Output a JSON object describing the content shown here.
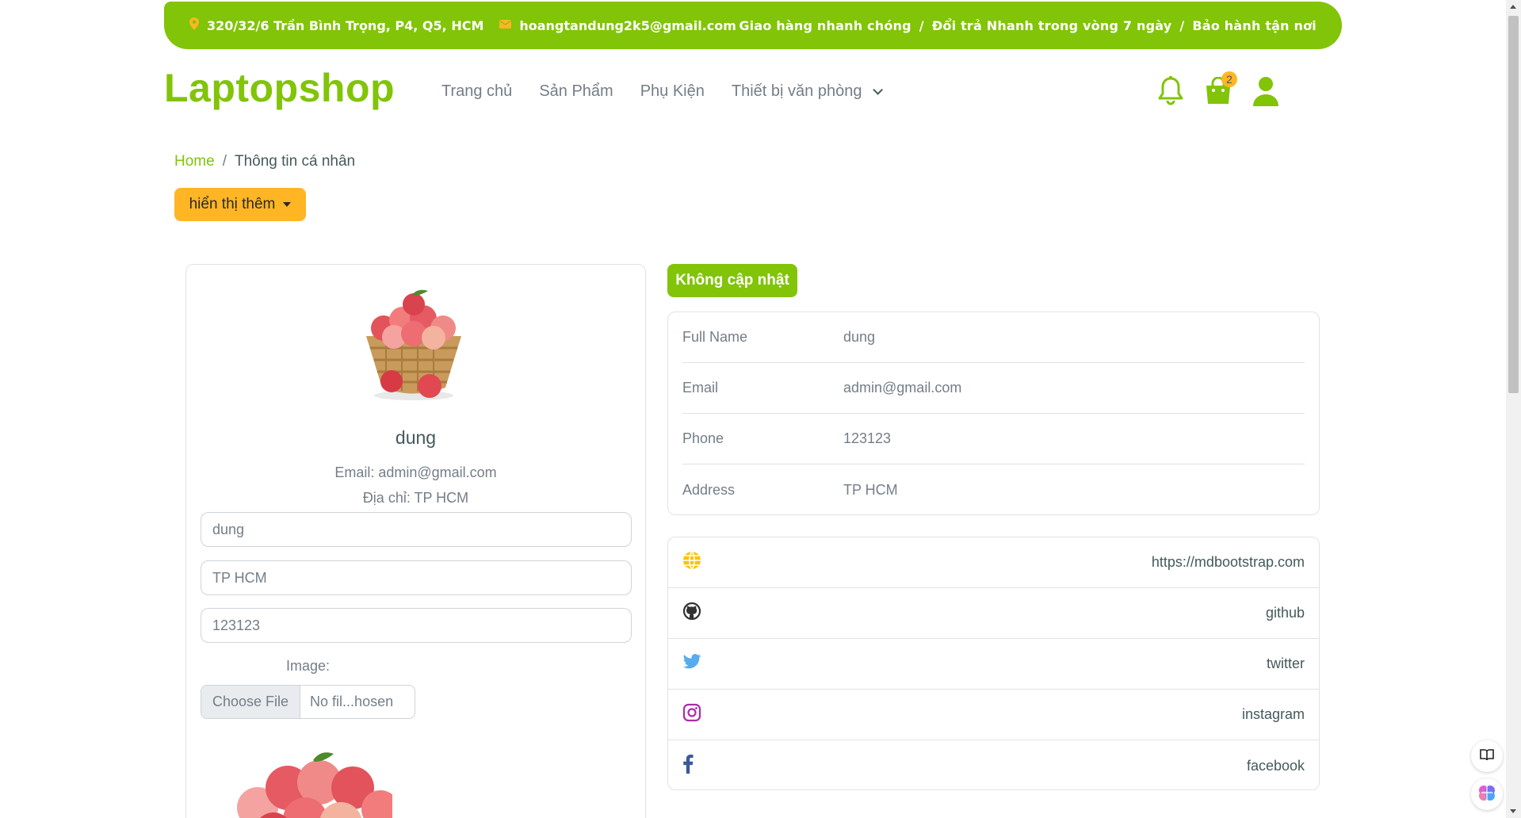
{
  "topbar": {
    "address": "320/32/6 Trần Bình Trọng, P4, Q5, HCM",
    "email": "hoangtandung2k5@gmail.com",
    "promo1": "Giao hàng nhanh chóng",
    "promo2": "Đổi trả Nhanh trong vòng 7 ngày",
    "promo3": "Bảo hành tận nơi",
    "sep": "/"
  },
  "brand": "Laptopshop",
  "nav": {
    "home": "Trang chủ",
    "products": "Sản Phẩm",
    "accessories": "Phụ Kiện",
    "office": "Thiết bị văn phòng"
  },
  "cart": {
    "count": "2"
  },
  "breadcrumb": {
    "home": "Home",
    "sep": "/",
    "current": "Thông tin cá nhân"
  },
  "more_button": "hiển thị thêm",
  "profile": {
    "name": "dung",
    "email_line": "Email: admin@gmail.com",
    "address_line": "Địa chỉ: TP HCM",
    "inputs": {
      "name": "dung",
      "address": "TP HCM",
      "phone": "123123"
    },
    "image_label": "Image:",
    "file_button": "Choose File",
    "file_name": "No fil...hosen"
  },
  "no_update_button": "Không cập nhật",
  "info": [
    {
      "label": "Full Name",
      "value": "dung"
    },
    {
      "label": "Email",
      "value": "admin@gmail.com"
    },
    {
      "label": "Phone",
      "value": "123123"
    },
    {
      "label": "Address",
      "value": "TP HCM"
    }
  ],
  "social": [
    {
      "icon": "globe-icon",
      "text": "https://mdbootstrap.com",
      "color": "#ffc107"
    },
    {
      "icon": "github-icon",
      "text": "github",
      "color": "#333333"
    },
    {
      "icon": "twitter-icon",
      "text": "twitter",
      "color": "#55acee"
    },
    {
      "icon": "instagram-icon",
      "text": "instagram",
      "color": "#ac2bac"
    },
    {
      "icon": "facebook-icon",
      "text": "facebook",
      "color": "#3b5998"
    }
  ],
  "colors": {
    "primary": "#81c408",
    "secondary": "#ffb524",
    "text": "#45595b",
    "muted": "#747d88"
  }
}
